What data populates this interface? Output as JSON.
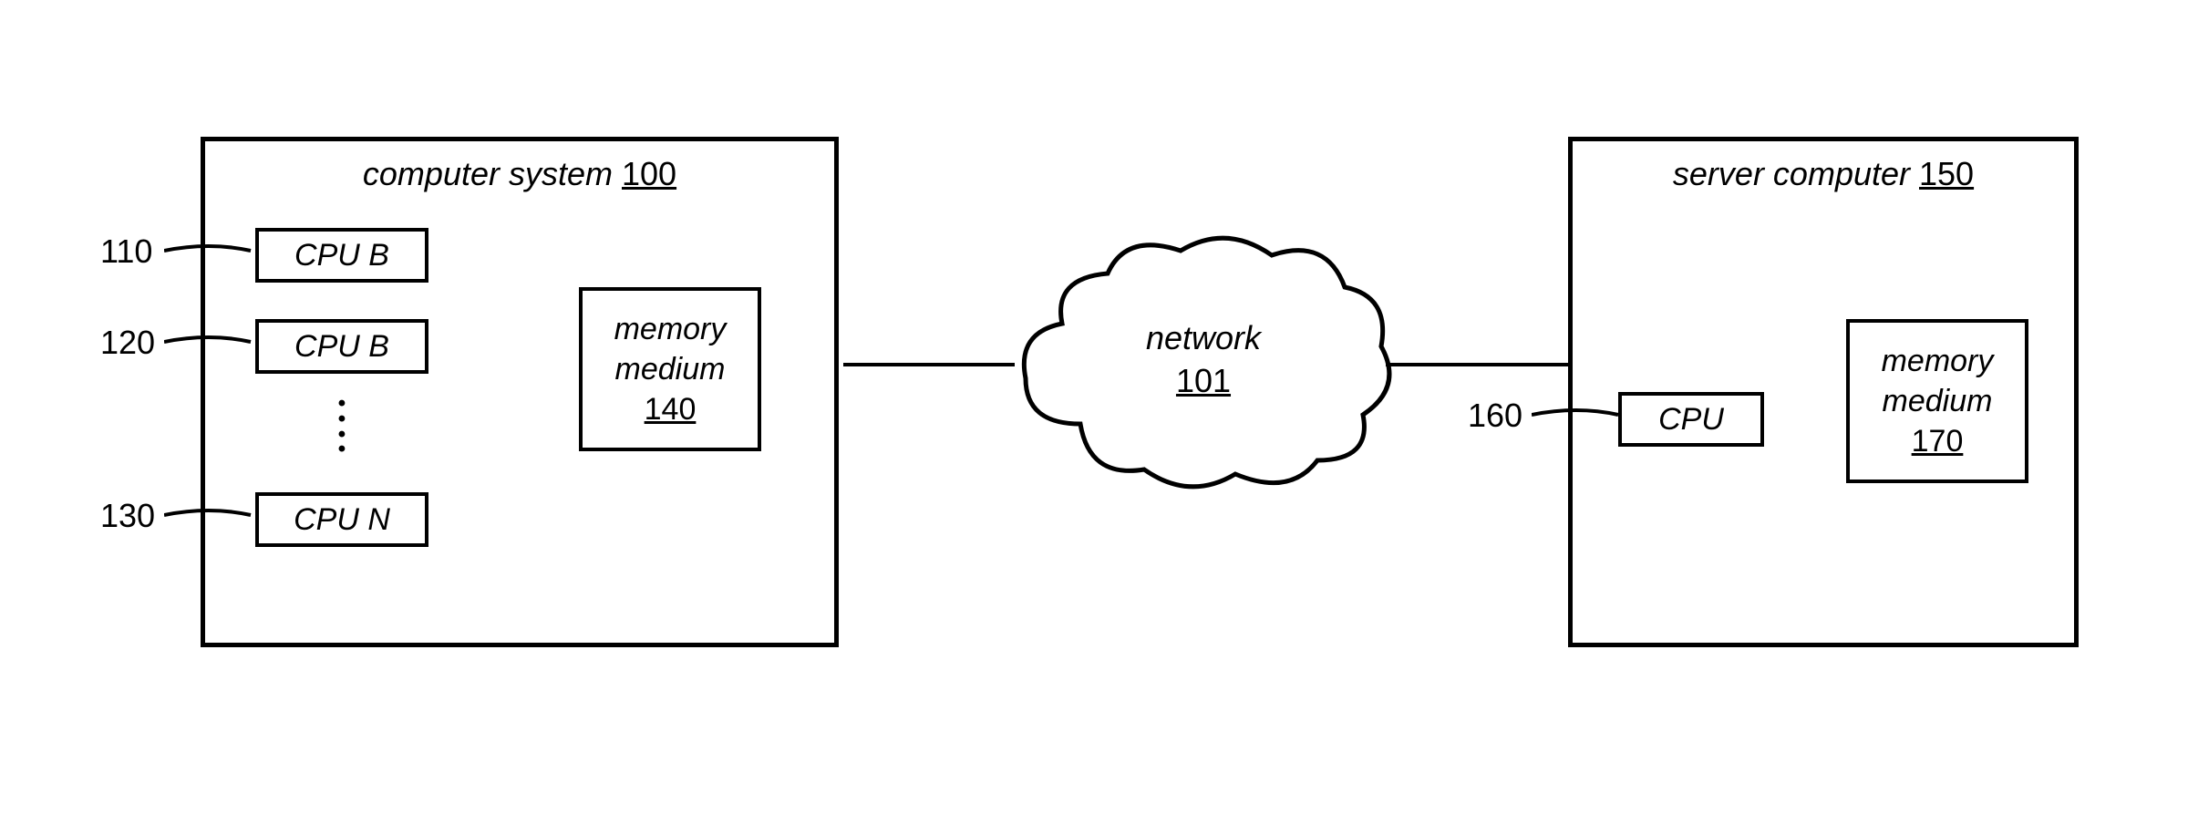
{
  "computer_system": {
    "title_text": "computer system",
    "title_num": "100",
    "cpus": [
      {
        "label": "CPU B",
        "ref": "110"
      },
      {
        "label": "CPU B",
        "ref": "120"
      },
      {
        "label": "CPU N",
        "ref": "130"
      }
    ],
    "memory": {
      "line1": "memory",
      "line2": "medium",
      "num": "140"
    }
  },
  "network": {
    "label": "network",
    "num": "101"
  },
  "server_computer": {
    "title_text": "server computer",
    "title_num": "150",
    "cpu": {
      "label": "CPU",
      "ref": "160"
    },
    "memory": {
      "line1": "memory",
      "line2": "medium",
      "num": "170"
    }
  }
}
